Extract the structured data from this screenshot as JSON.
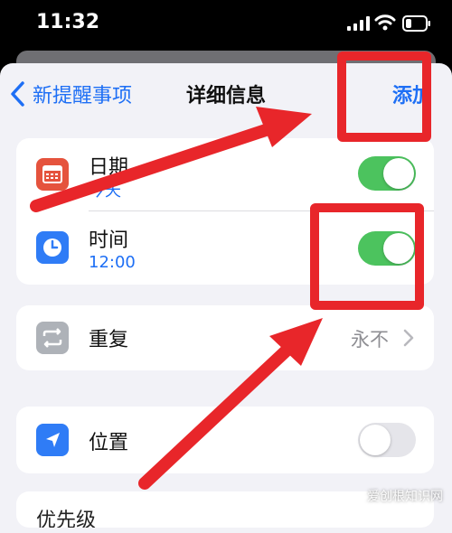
{
  "status_bar": {
    "time": "11:32"
  },
  "nav": {
    "back_label": "新提醒事项",
    "title": "详细信息",
    "add_label": "添加"
  },
  "rows": {
    "date": {
      "label": "日期",
      "sub": "今天",
      "toggle_on": true
    },
    "time": {
      "label": "时间",
      "sub": "12:00",
      "toggle_on": true
    },
    "repeat": {
      "label": "重复",
      "value": "永不"
    },
    "location": {
      "label": "位置",
      "toggle_on": false
    },
    "next_partial": {
      "label": "优先级"
    }
  },
  "watermark": "爱创根知识网",
  "colors": {
    "accent": "#1e6ff5",
    "toggle_on": "#4cc35e",
    "highlight": "#e8262a",
    "date_icon": "#e5533d",
    "time_icon": "#2f7cf6",
    "repeat_icon": "#aeb2b8",
    "location_icon": "#2f7cf6"
  },
  "icons": {
    "date": "calendar-icon",
    "time": "clock-icon",
    "repeat": "repeat-arrows-icon",
    "location": "location-arrow-icon"
  }
}
